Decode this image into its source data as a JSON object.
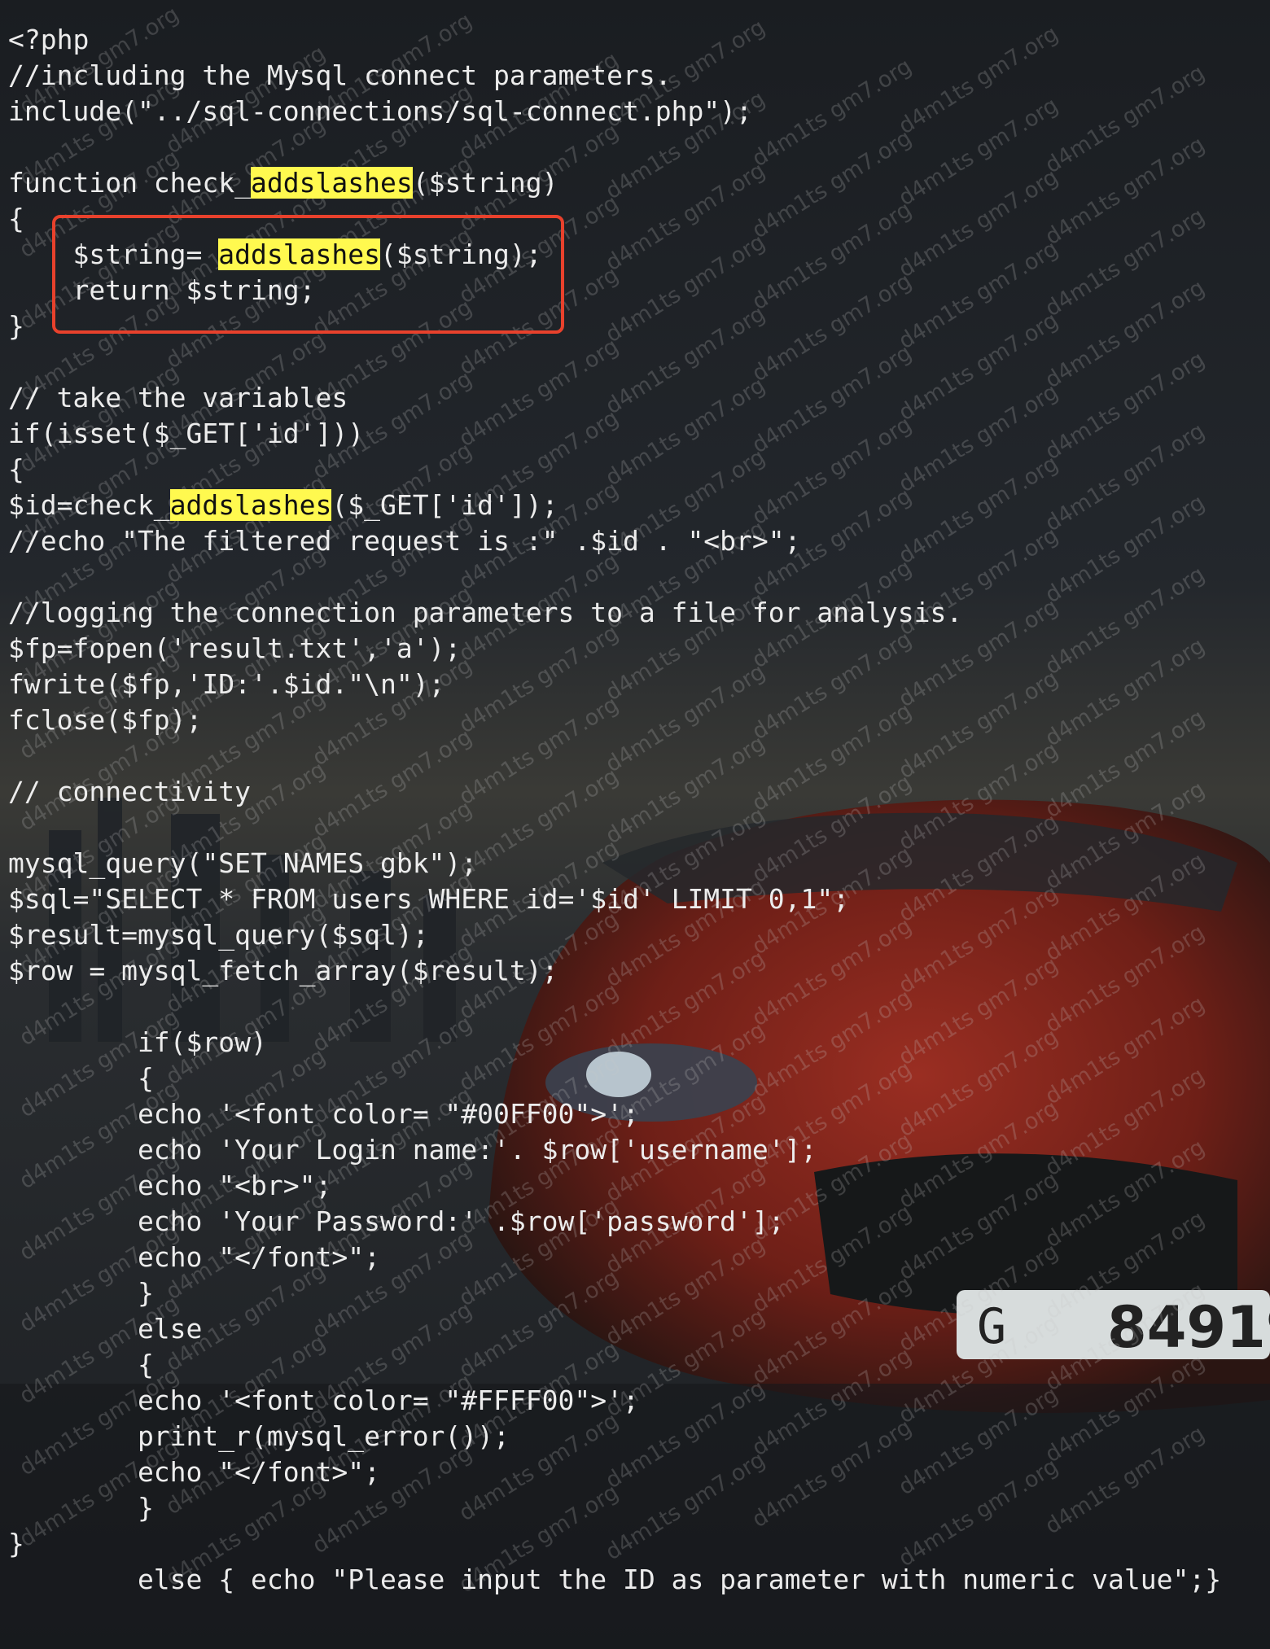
{
  "watermark": "d4m1ts gm7.org",
  "colors": {
    "highlight": "#fff94f",
    "annotation_box": "#e8412c",
    "code_text": "#ececec"
  },
  "code": {
    "language": "php",
    "lines": [
      [
        {
          "t": "<?php"
        }
      ],
      [
        {
          "t": "//including the Mysql connect parameters."
        }
      ],
      [
        {
          "t": "include(\"../sql-connections/sql-connect.php\");"
        }
      ],
      [
        {
          "t": ""
        }
      ],
      [
        {
          "t": "function check_"
        },
        {
          "t": "addslashes",
          "hl": true
        },
        {
          "t": "($string)"
        }
      ],
      [
        {
          "t": "{"
        }
      ],
      [
        {
          "t": "    $string= "
        },
        {
          "t": "addslashes",
          "hl": true
        },
        {
          "t": "($string);"
        }
      ],
      [
        {
          "t": "    return $string;"
        }
      ],
      [
        {
          "t": "}"
        }
      ],
      [
        {
          "t": ""
        }
      ],
      [
        {
          "t": "// take the variables"
        }
      ],
      [
        {
          "t": "if(isset($_GET['id']))"
        }
      ],
      [
        {
          "t": "{"
        }
      ],
      [
        {
          "t": "$id=check_"
        },
        {
          "t": "addslashes",
          "hl": true
        },
        {
          "t": "($_GET['id']);"
        }
      ],
      [
        {
          "t": "//echo \"The filtered request is :\" .$id . \"<br>\";"
        }
      ],
      [
        {
          "t": ""
        }
      ],
      [
        {
          "t": "//logging the connection parameters to a file for analysis."
        }
      ],
      [
        {
          "t": "$fp=fopen('result.txt','a');"
        }
      ],
      [
        {
          "t": "fwrite($fp,'ID:'.$id.\"\\n\");"
        }
      ],
      [
        {
          "t": "fclose($fp);"
        }
      ],
      [
        {
          "t": ""
        }
      ],
      [
        {
          "t": "// connectivity"
        }
      ],
      [
        {
          "t": ""
        }
      ],
      [
        {
          "t": "mysql_query(\"SET NAMES gbk\");"
        }
      ],
      [
        {
          "t": "$sql=\"SELECT * FROM users WHERE id='$id' LIMIT 0,1\";"
        }
      ],
      [
        {
          "t": "$result=mysql_query($sql);"
        }
      ],
      [
        {
          "t": "$row = mysql_fetch_array($result);"
        }
      ],
      [
        {
          "t": ""
        }
      ],
      [
        {
          "t": "        if($row)"
        }
      ],
      [
        {
          "t": "        {"
        }
      ],
      [
        {
          "t": "        echo '<font color= \"#00FF00\">';"
        }
      ],
      [
        {
          "t": "        echo 'Your Login name:'. $row['username'];"
        }
      ],
      [
        {
          "t": "        echo \"<br>\";"
        }
      ],
      [
        {
          "t": "        echo 'Your Password:' .$row['password'];"
        }
      ],
      [
        {
          "t": "        echo \"</font>\";"
        }
      ],
      [
        {
          "t": "        }"
        }
      ],
      [
        {
          "t": "        else"
        }
      ],
      [
        {
          "t": "        {"
        }
      ],
      [
        {
          "t": "        echo '<font color= \"#FFFF00\">';"
        }
      ],
      [
        {
          "t": "        print_r(mysql_error());"
        }
      ],
      [
        {
          "t": "        echo \"</font>\";"
        }
      ],
      [
        {
          "t": "        }"
        }
      ],
      [
        {
          "t": "}"
        }
      ],
      [
        {
          "t": "        else { echo \"Please input the ID as parameter with numeric value\";}"
        }
      ]
    ]
  }
}
